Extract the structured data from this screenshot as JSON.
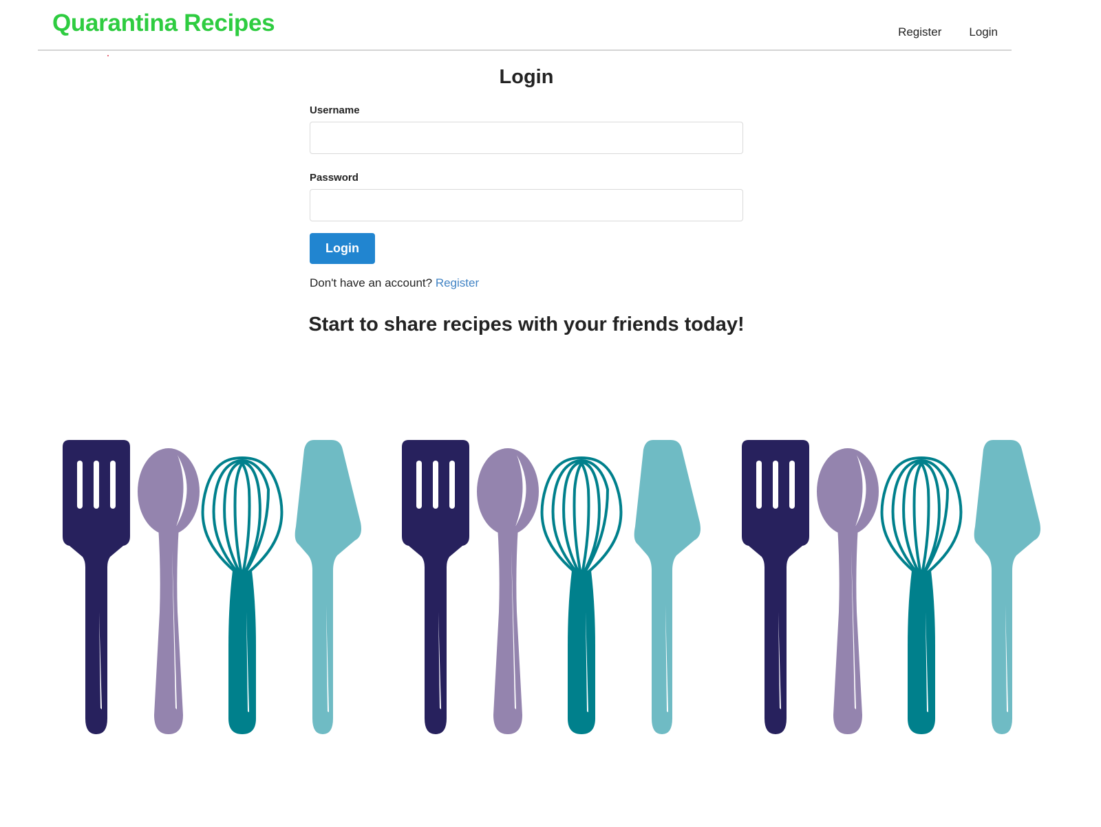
{
  "navbar": {
    "brand": "Quarantina Recipes",
    "links": [
      "Register",
      "Login"
    ]
  },
  "login_form": {
    "title": "Login",
    "username_label": "Username",
    "username_value": "",
    "password_label": "Password",
    "password_value": "",
    "submit_label": "Login",
    "register_prompt": "Don't have an account?",
    "register_link": "Register"
  },
  "tagline": "Start to share recipes with your friends today!",
  "illustration": {
    "icons": [
      "spatula-icon",
      "spoon-icon",
      "whisk-icon",
      "pie-server-icon"
    ],
    "repeat": 3,
    "colors": {
      "spatula": "#27215d",
      "spoon": "#9484ae",
      "whisk": "#00808c",
      "pie_server": "#6fbbc4"
    }
  },
  "colors": {
    "brand": "#2ecc40",
    "primary_button": "#2185d0",
    "link": "#4183c4",
    "divider": "#d4d4d4"
  }
}
